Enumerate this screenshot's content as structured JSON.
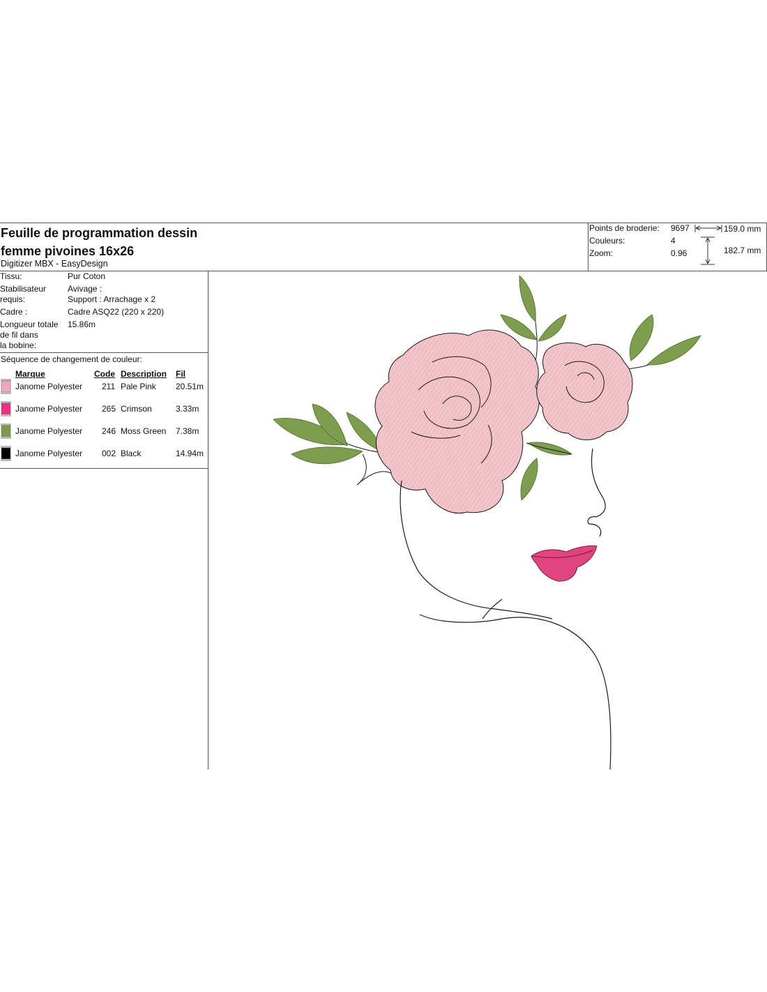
{
  "header": {
    "title_line1": "Feuille de programmation dessin",
    "title_line2": "femme pivoines 16x26",
    "subtitle": "Digitizer MBX - EasyDesign"
  },
  "stats": {
    "points_label": "Points de broderie:",
    "points_value": "9697",
    "colors_label": "Couleurs:",
    "colors_value": "4",
    "zoom_label": "Zoom:",
    "zoom_value": "0.96",
    "width": "159.0 mm",
    "height": "182.7 mm"
  },
  "info": {
    "fabric_label": "Tissu:",
    "fabric_value": "Pur Coton",
    "stabilizer_label_1": "Stabilisateur",
    "stabilizer_label_2": "requis:",
    "stabilizer_value_1": "Avivage :",
    "stabilizer_value_2": "Support : Arrachage x 2",
    "frame_label": "Cadre :",
    "frame_value": "Cadre ASQ22 (220 x 220)",
    "thread_label_1": "Longueur totale",
    "thread_label_2": "de fil dans",
    "thread_label_3": "la bobine:",
    "thread_value": "15.86m"
  },
  "sequence": {
    "title": "Séquence de changement de couleur:",
    "headers": {
      "brand": "Marque",
      "code": "Code",
      "description": "Description",
      "thread": "Fil"
    },
    "rows": [
      {
        "brand": "Janome Polyester",
        "code": "211",
        "description": "Pale Pink",
        "thread": "20.51m",
        "color": "#f2a7bd"
      },
      {
        "brand": "Janome Polyester",
        "code": "265",
        "description": "Crimson",
        "thread": "3.33m",
        "color": "#e8327f"
      },
      {
        "brand": "Janome Polyester",
        "code": "246",
        "description": "Moss Green",
        "thread": "7.38m",
        "color": "#7e9a4a"
      },
      {
        "brand": "Janome Polyester",
        "code": "002",
        "description": "Black",
        "thread": "14.94m",
        "color": "#000000"
      }
    ]
  },
  "artwork": {
    "petal_color": "#f1c6cb",
    "petal_shade": "#e7a7b1",
    "leaf_color": "#7f9d4e",
    "lip_color": "#e0457f",
    "line_color": "#1a1a1a"
  }
}
